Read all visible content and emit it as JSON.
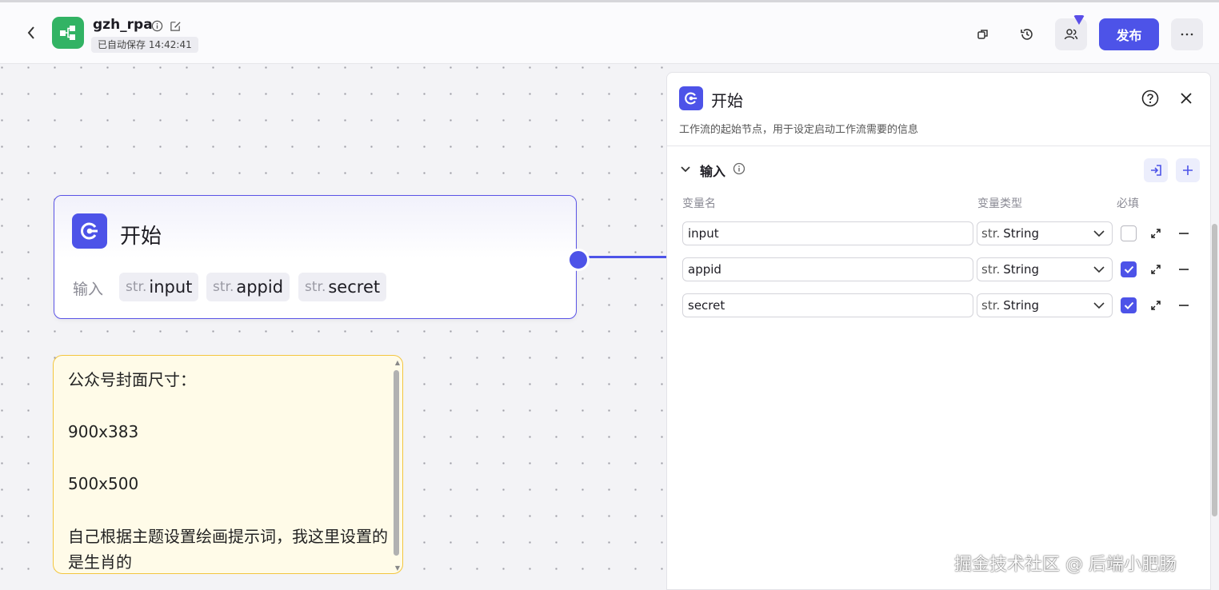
{
  "header": {
    "title": "gzh_rpa",
    "save_status": "已自动保存 14:42:41",
    "publish_label": "发布",
    "app_icon": "workflow-icon",
    "accent_color": "#4d53e8"
  },
  "canvas": {
    "start_node": {
      "title": "开始",
      "input_label": "输入",
      "variables": [
        {
          "type": "str.",
          "name": "input"
        },
        {
          "type": "str.",
          "name": "appid"
        },
        {
          "type": "str.",
          "name": "secret"
        }
      ]
    },
    "note": {
      "text": "公众号封面尺寸：\n\n900x383\n\n500x500\n\n自己根据主题设置绘画提示词，我这里设置的是生肖的"
    }
  },
  "panel": {
    "title": "开始",
    "description": "工作流的起始节点，用于设定启动工作流需要的信息",
    "section_title": "输入",
    "columns": {
      "name": "变量名",
      "type": "变量类型",
      "required": "必填"
    },
    "rows": [
      {
        "name": "input",
        "type_prefix": "str.",
        "type": "String",
        "required": false
      },
      {
        "name": "appid",
        "type_prefix": "str.",
        "type": "String",
        "required": true
      },
      {
        "name": "secret",
        "type_prefix": "str.",
        "type": "String",
        "required": true
      }
    ]
  },
  "watermark": "掘金技术社区 @ 后端小肥肠"
}
